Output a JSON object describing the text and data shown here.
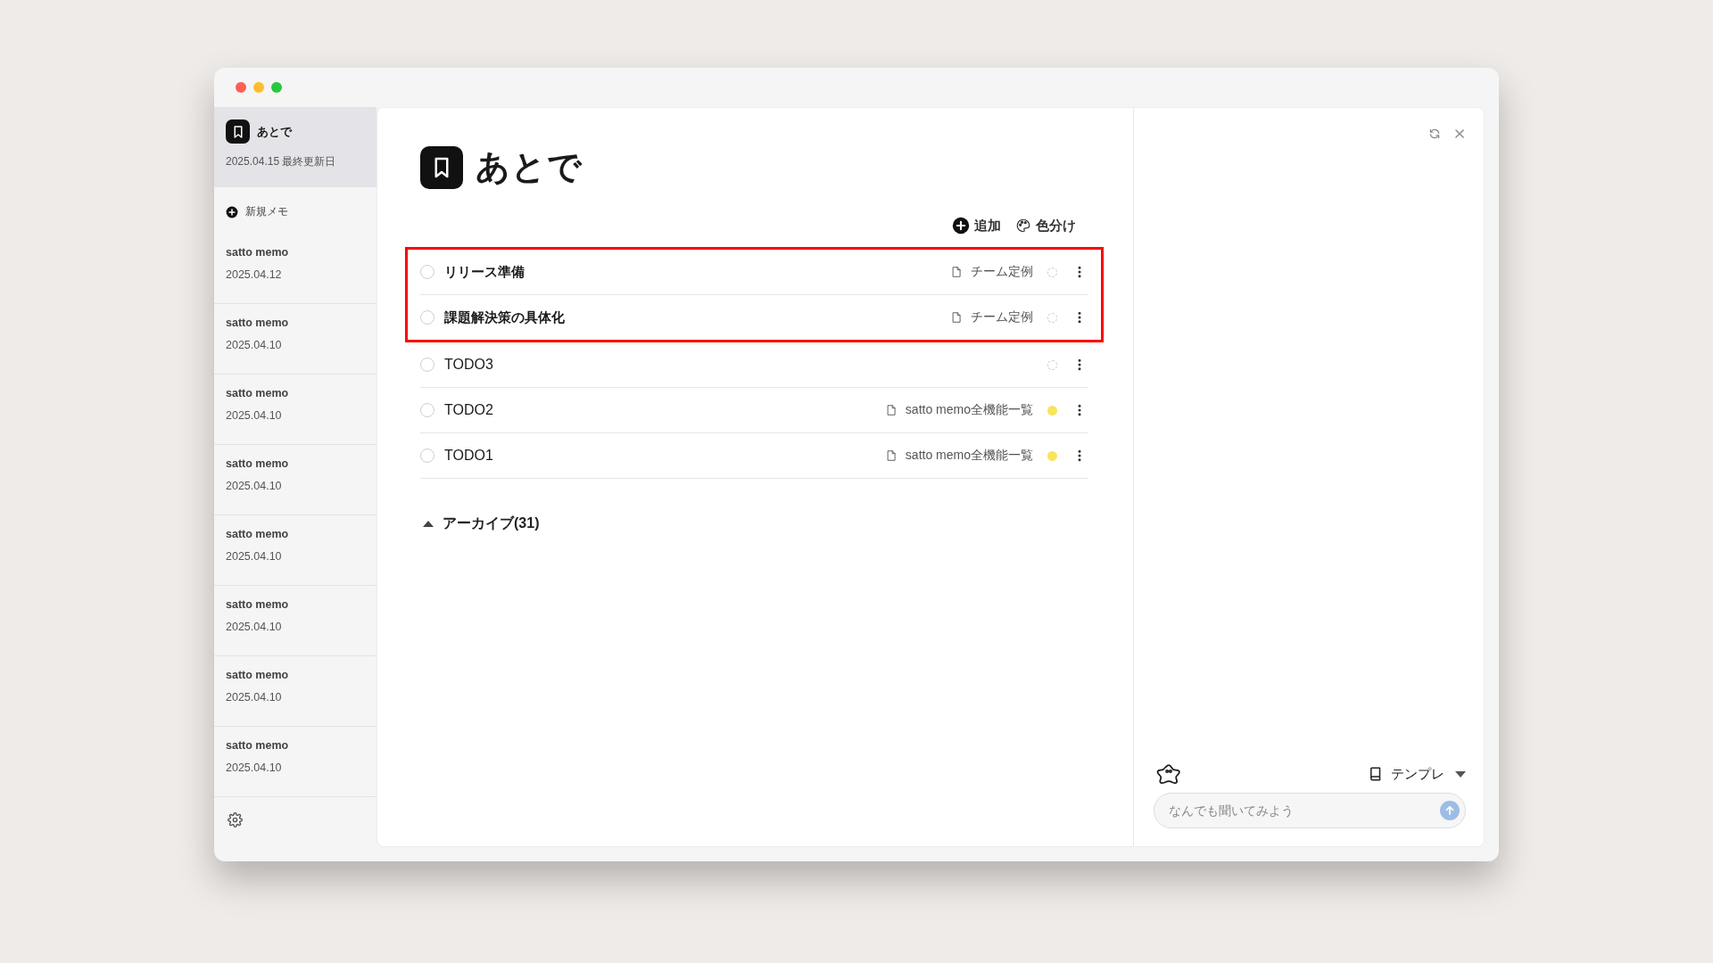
{
  "sidebar": {
    "current": {
      "title": "あとで",
      "updated": "2025.04.15 最終更新日",
      "selected": true
    },
    "new_memo": "新規メモ",
    "items": [
      {
        "title": "satto memo",
        "date": "2025.04.12",
        "selected": false
      },
      {
        "title": "satto memo",
        "date": "2025.04.10",
        "selected": false
      },
      {
        "title": "satto memo",
        "date": "2025.04.10",
        "selected": false
      },
      {
        "title": "satto memo",
        "date": "2025.04.10",
        "selected": false
      },
      {
        "title": "satto memo",
        "date": "2025.04.10",
        "selected": false
      },
      {
        "title": "satto memo",
        "date": "2025.04.10",
        "selected": false
      },
      {
        "title": "satto memo",
        "date": "2025.04.10",
        "selected": false
      },
      {
        "title": "satto memo",
        "date": "2025.04.10",
        "selected": false
      }
    ]
  },
  "page": {
    "title": "あとで",
    "toolbar": {
      "add": "追加",
      "coloring": "色分け"
    },
    "todos": [
      {
        "text": "リリース準備",
        "bold": true,
        "checked": false,
        "highlighted": true,
        "source": "チーム定例"
      },
      {
        "text": "課題解決策の具体化",
        "bold": true,
        "checked": false,
        "highlighted": true,
        "source": "チーム定例"
      },
      {
        "text": "TODO3",
        "bold": false,
        "checked": false,
        "highlighted": false
      },
      {
        "text": "TODO2",
        "bold": false,
        "checked": false,
        "highlighted": false,
        "source": "satto memo全機能一覧",
        "color": "#f7e55c"
      },
      {
        "text": "TODO1",
        "bold": false,
        "checked": false,
        "highlighted": false,
        "source": "satto memo全機能一覧",
        "color": "#f7e55c"
      }
    ],
    "archive": {
      "label": "アーカイブ(31)",
      "expanded": false
    }
  },
  "chat": {
    "template": "テンプレ",
    "placeholder": "なんでも聞いてみよう"
  }
}
